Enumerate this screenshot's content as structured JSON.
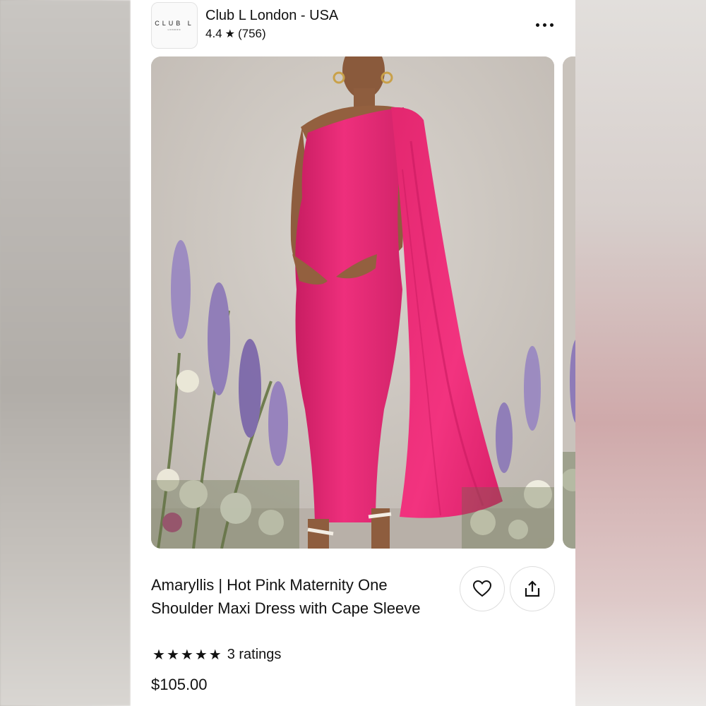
{
  "shop": {
    "logo_text": "CLUB L",
    "logo_subtext": "LONDON",
    "name": "Club L London - USA",
    "rating": "4.4",
    "review_count": "(756)"
  },
  "product": {
    "title": "Amaryllis | Hot Pink Maternity One Shoulder Maxi Dress with Cape Sleeve",
    "ratings_label": "3 ratings",
    "star_count": 5,
    "price": "$105.00",
    "dress_color": "#ec2a78"
  },
  "icons": {
    "more": "more-horizontal-icon",
    "favorite": "heart-icon",
    "share": "share-icon",
    "star": "star-icon"
  }
}
